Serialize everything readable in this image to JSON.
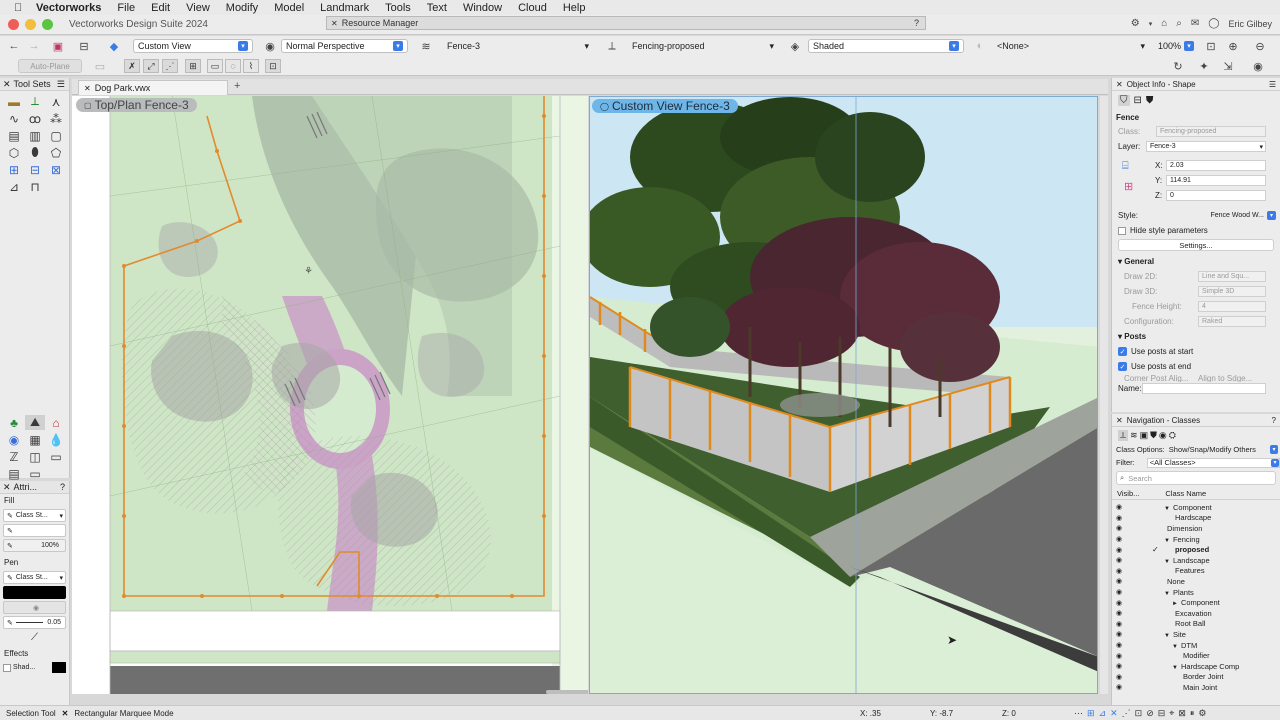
{
  "menubar": {
    "app": "Vectorworks",
    "items": [
      "File",
      "Edit",
      "View",
      "Modify",
      "Model",
      "Landmark",
      "Tools",
      "Text",
      "Window",
      "Cloud",
      "Help"
    ]
  },
  "titlebar": {
    "app_title": "Vectorworks Design Suite 2024",
    "resource_manager": "Resource Manager"
  },
  "top_right": {
    "user": "Eric Gilbey"
  },
  "toolbar1": {
    "view_name": "Custom View",
    "projection": "Normal Perspective",
    "layer": "Fence-3",
    "class": "Fencing-proposed",
    "render_mode": "Shaded",
    "saved_view": "<None>",
    "zoom": "100%"
  },
  "toolbar2": {
    "auto_plane": "Auto-Plane"
  },
  "toolsets": {
    "title": "Tool Sets"
  },
  "attributes": {
    "title": "Attri...",
    "fill_label": "Fill",
    "fill_style": "Class St...",
    "opacity": "100%",
    "pen_label": "Pen",
    "pen_style": "Class St...",
    "line_weight": "0.05",
    "effects_label": "Effects",
    "shadow": "Shad..."
  },
  "document": {
    "tab": "Dog Park.vwx"
  },
  "views": {
    "left_label": "Top/Plan  Fence-3",
    "right_label": "Custom View  Fence-3"
  },
  "object_info": {
    "title": "Object Info - Shape",
    "object_type": "Fence",
    "class_label": "Class:",
    "class_value": "Fencing-proposed",
    "layer_label": "Layer:",
    "layer_value": "Fence-3",
    "x_label": "X:",
    "x_value": "2.03",
    "y_label": "Y:",
    "y_value": "114.91",
    "z_label": "Z:",
    "z_value": "0",
    "style_label": "Style:",
    "style_value": "Fence Wood W...",
    "hide_style": "Hide style parameters",
    "settings": "Settings...",
    "general": "General",
    "draw2d_label": "Draw 2D:",
    "draw2d_value": "Line and Squ...",
    "draw3d_label": "Draw 3D:",
    "draw3d_value": "Simple 3D",
    "fence_height_label": "Fence Height:",
    "fence_height_value": "4",
    "configuration_label": "Configuration:",
    "configuration_value": "Raked",
    "posts": "Posts",
    "use_posts_start": "Use posts at start",
    "use_posts_end": "Use posts at end",
    "corner_post": "Corner Post Alig...",
    "corner_post_value": "Align to Sdge...",
    "name_label": "Name:"
  },
  "navigation": {
    "title": "Navigation - Classes",
    "class_options_label": "Class Options:",
    "class_options_value": "Show/Snap/Modify Others",
    "filter_label": "Filter:",
    "filter_value": "<All Classes>",
    "search_placeholder": "Search",
    "col_visibility": "Visib...",
    "col_class_name": "Class Name",
    "classes": [
      {
        "indent": 1,
        "arrow": "▼",
        "name": "Component",
        "active": false
      },
      {
        "indent": 2,
        "arrow": "",
        "name": "Hardscape",
        "active": false
      },
      {
        "indent": 1,
        "arrow": "",
        "name": "Dimension",
        "active": false
      },
      {
        "indent": 1,
        "arrow": "▼",
        "name": "Fencing",
        "active": false
      },
      {
        "indent": 2,
        "arrow": "",
        "name": "proposed",
        "active": true
      },
      {
        "indent": 1,
        "arrow": "▼",
        "name": "Landscape",
        "active": false
      },
      {
        "indent": 2,
        "arrow": "",
        "name": "Features",
        "active": false
      },
      {
        "indent": 1,
        "arrow": "",
        "name": "None",
        "active": false
      },
      {
        "indent": 1,
        "arrow": "▼",
        "name": "Plants",
        "active": false
      },
      {
        "indent": 2,
        "arrow": "►",
        "name": "Component",
        "active": false
      },
      {
        "indent": 2,
        "arrow": "",
        "name": "Excavation",
        "active": false
      },
      {
        "indent": 2,
        "arrow": "",
        "name": "Root Ball",
        "active": false
      },
      {
        "indent": 1,
        "arrow": "▼",
        "name": "Site",
        "active": false
      },
      {
        "indent": 2,
        "arrow": "▼",
        "name": "DTM",
        "active": false
      },
      {
        "indent": 3,
        "arrow": "",
        "name": "Modifier",
        "active": false
      },
      {
        "indent": 2,
        "arrow": "▼",
        "name": "Hardscape Comp",
        "active": false
      },
      {
        "indent": 3,
        "arrow": "",
        "name": "Border Joint",
        "active": false
      },
      {
        "indent": 3,
        "arrow": "",
        "name": "Main Joint",
        "active": false
      }
    ]
  },
  "status": {
    "tool": "Selection Tool",
    "mode": "Rectangular Marquee Mode",
    "x": "X: .35",
    "y": "Y: -8.7",
    "z": "Z: 0"
  }
}
